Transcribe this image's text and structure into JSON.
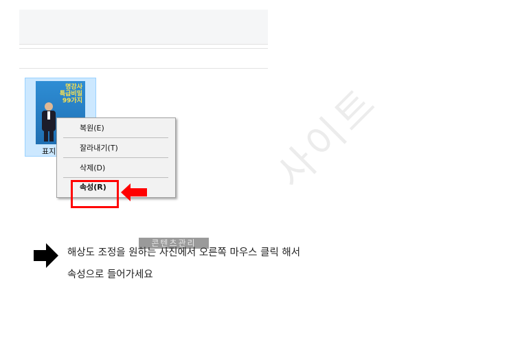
{
  "file": {
    "thumbnail_title": "명강사\n특급비밀\n99가지",
    "label": "표지"
  },
  "context_menu": {
    "items": [
      {
        "label": "복원(E)"
      },
      {
        "label": "잘라내기(T)"
      },
      {
        "label": "삭제(D)"
      },
      {
        "label": "속성(R)"
      }
    ]
  },
  "watermark": {
    "text": "사이트",
    "tag": "콘텐츠관리"
  },
  "instruction": {
    "line1": "해상도 조정을 원하는 사진에서 오른쪽 마우스 클릭 해서",
    "line2": "속성으로 들어가세요"
  },
  "colors": {
    "highlight": "#ff0000",
    "selection": "#cce8ff",
    "arrow": "#000000"
  },
  "icons": [
    "red-arrow-icon",
    "black-arrow-icon"
  ]
}
